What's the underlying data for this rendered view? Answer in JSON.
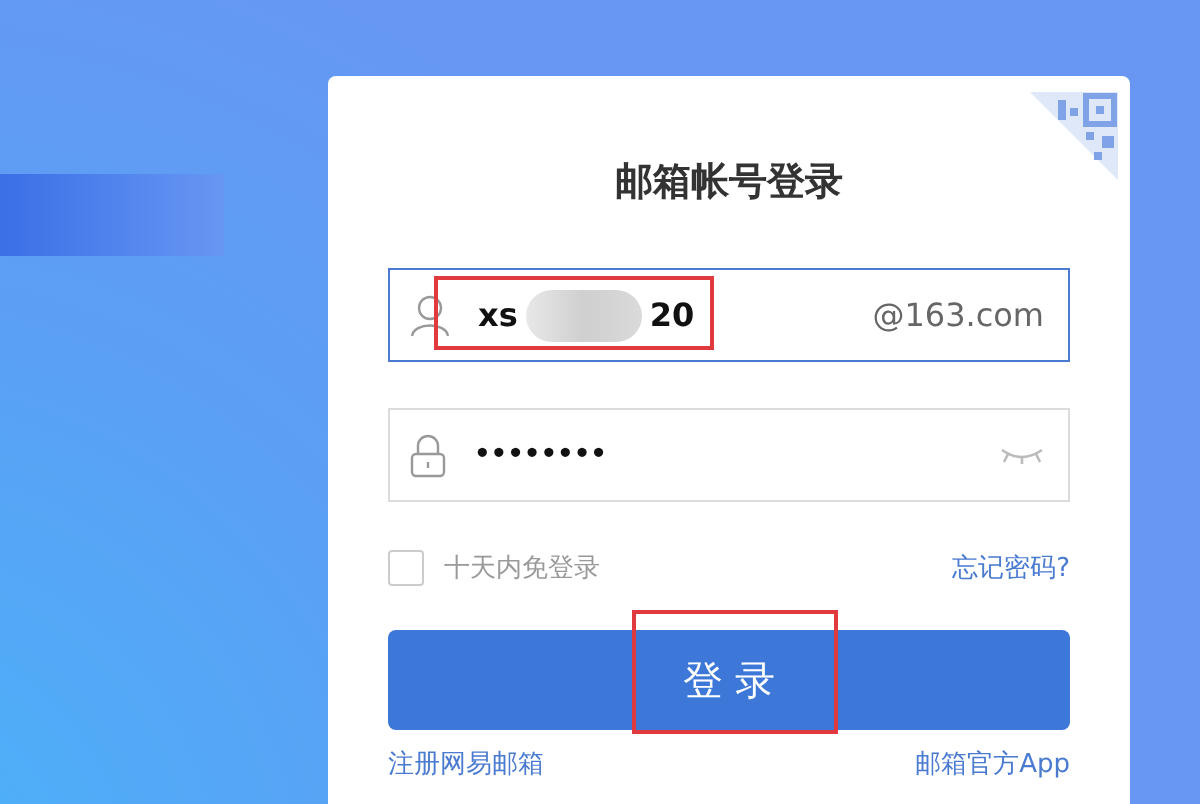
{
  "login_card": {
    "title": "邮箱帐号登录",
    "username": {
      "value_start": "xs",
      "value_end": "20",
      "redacted": true,
      "highlighted": true,
      "suffix": "@163.com"
    },
    "password": {
      "value": "••••••••"
    },
    "remember": {
      "label": "十天内免登录",
      "checked": false
    },
    "forgot_link": "忘记密码?",
    "login_button": {
      "label": "登 录",
      "highlighted": true
    },
    "footer_links": [
      "注册网易邮箱",
      "邮箱官方App"
    ]
  }
}
